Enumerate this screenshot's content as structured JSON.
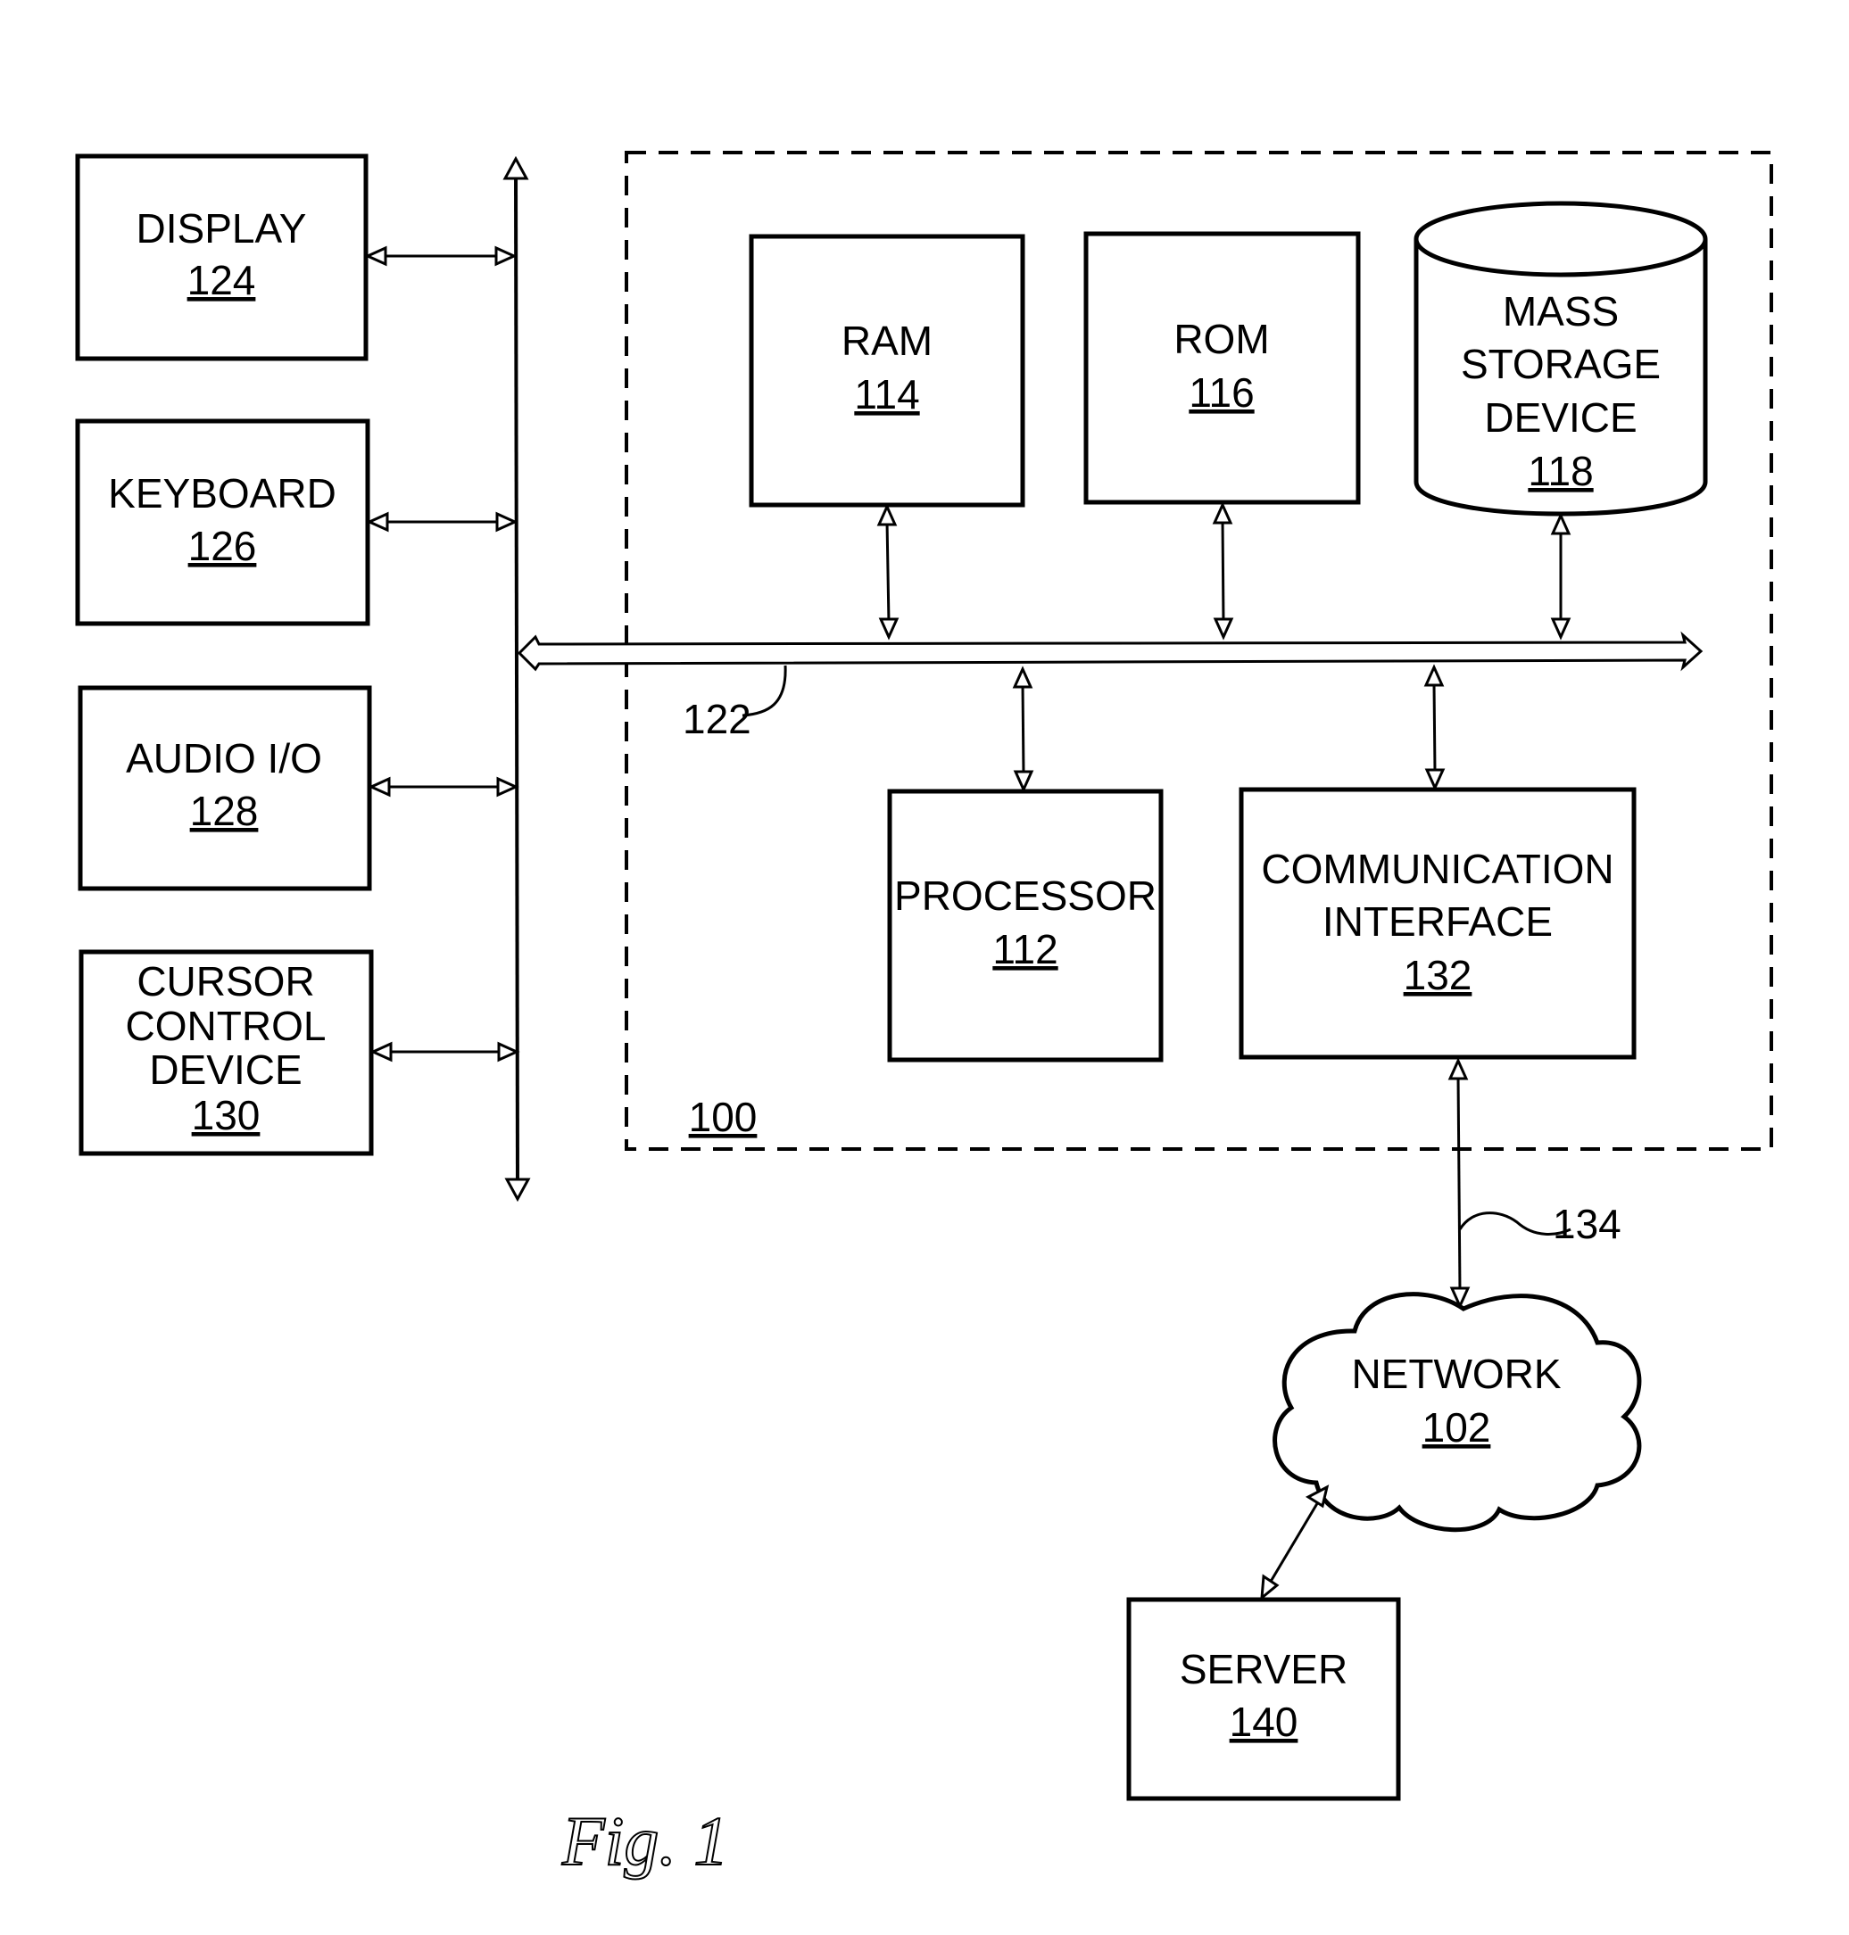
{
  "figure": {
    "caption": "Fig. 1",
    "system_ref": "100",
    "bus_ref": "122",
    "link_ref": "134"
  },
  "peripherals": [
    {
      "id": "display",
      "lines": [
        "DISPLAY"
      ],
      "ref": "124"
    },
    {
      "id": "keyboard",
      "lines": [
        "KEYBOARD"
      ],
      "ref": "126"
    },
    {
      "id": "audio",
      "lines": [
        "AUDIO I/O"
      ],
      "ref": "128"
    },
    {
      "id": "cursor",
      "lines": [
        "CURSOR",
        "CONTROL",
        "DEVICE"
      ],
      "ref": "130"
    }
  ],
  "components": {
    "ram": {
      "lines": [
        "RAM"
      ],
      "ref": "114"
    },
    "rom": {
      "lines": [
        "ROM"
      ],
      "ref": "116"
    },
    "mass_storage": {
      "lines": [
        "MASS",
        "STORAGE",
        "DEVICE"
      ],
      "ref": "118"
    },
    "processor": {
      "lines": [
        "PROCESSOR"
      ],
      "ref": "112"
    },
    "comm": {
      "lines": [
        "COMMUNICATION",
        "INTERFACE"
      ],
      "ref": "132"
    }
  },
  "network": {
    "lines": [
      "NETWORK"
    ],
    "ref": "102"
  },
  "server": {
    "lines": [
      "SERVER"
    ],
    "ref": "140"
  },
  "colors": {
    "ink": "#000000",
    "paper": "#ffffff"
  }
}
